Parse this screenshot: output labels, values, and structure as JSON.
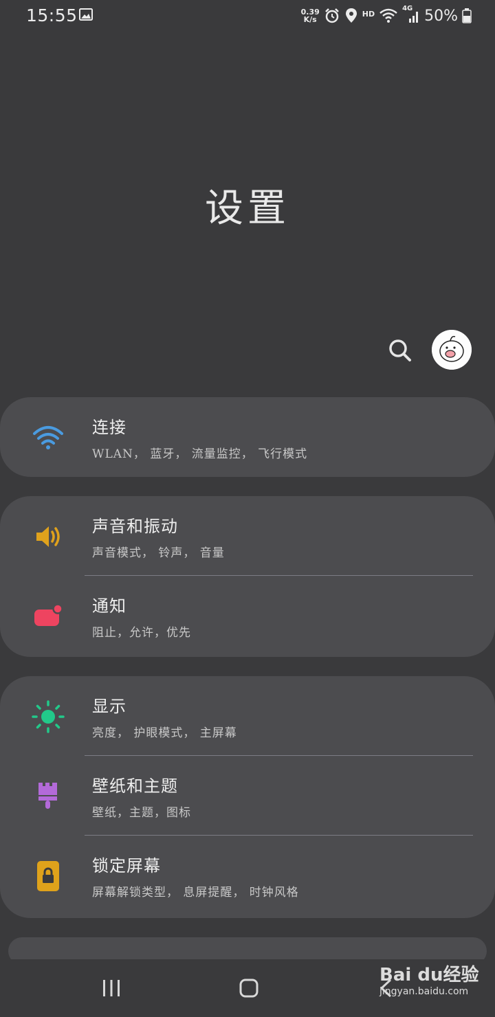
{
  "status_bar": {
    "time": "15:55",
    "net_speed_value": "0.39",
    "net_speed_unit": "K/s",
    "hd_label": "HD",
    "network_label": "4G",
    "battery": "50%"
  },
  "page": {
    "title": "设置"
  },
  "groups": [
    {
      "items": [
        {
          "title": "连接",
          "subtitle": "WLAN， 蓝牙， 流量监控， 飞行模式",
          "icon": "wifi-icon",
          "color": "#4a9be0"
        }
      ]
    },
    {
      "items": [
        {
          "title": "声音和振动",
          "subtitle": "声音模式， 铃声， 音量",
          "icon": "speaker-icon",
          "color": "#e0a21c"
        },
        {
          "title": "通知",
          "subtitle": "阻止，允许，优先",
          "icon": "notification-icon",
          "color": "#ee4460"
        }
      ]
    },
    {
      "items": [
        {
          "title": "显示",
          "subtitle": "亮度， 护眼模式， 主屏幕",
          "icon": "brightness-icon",
          "color": "#22c98a"
        },
        {
          "title": "壁纸和主题",
          "subtitle": "壁纸，主题，图标",
          "icon": "paintbrush-icon",
          "color": "#b36ad9"
        },
        {
          "title": "锁定屏幕",
          "subtitle": "屏幕解锁类型， 息屏提醒， 时钟风格",
          "icon": "lock-icon",
          "color": "#dfa21b"
        }
      ]
    }
  ],
  "watermark": {
    "main": "Bai du经验",
    "sub": "jingyan.baidu.com"
  }
}
